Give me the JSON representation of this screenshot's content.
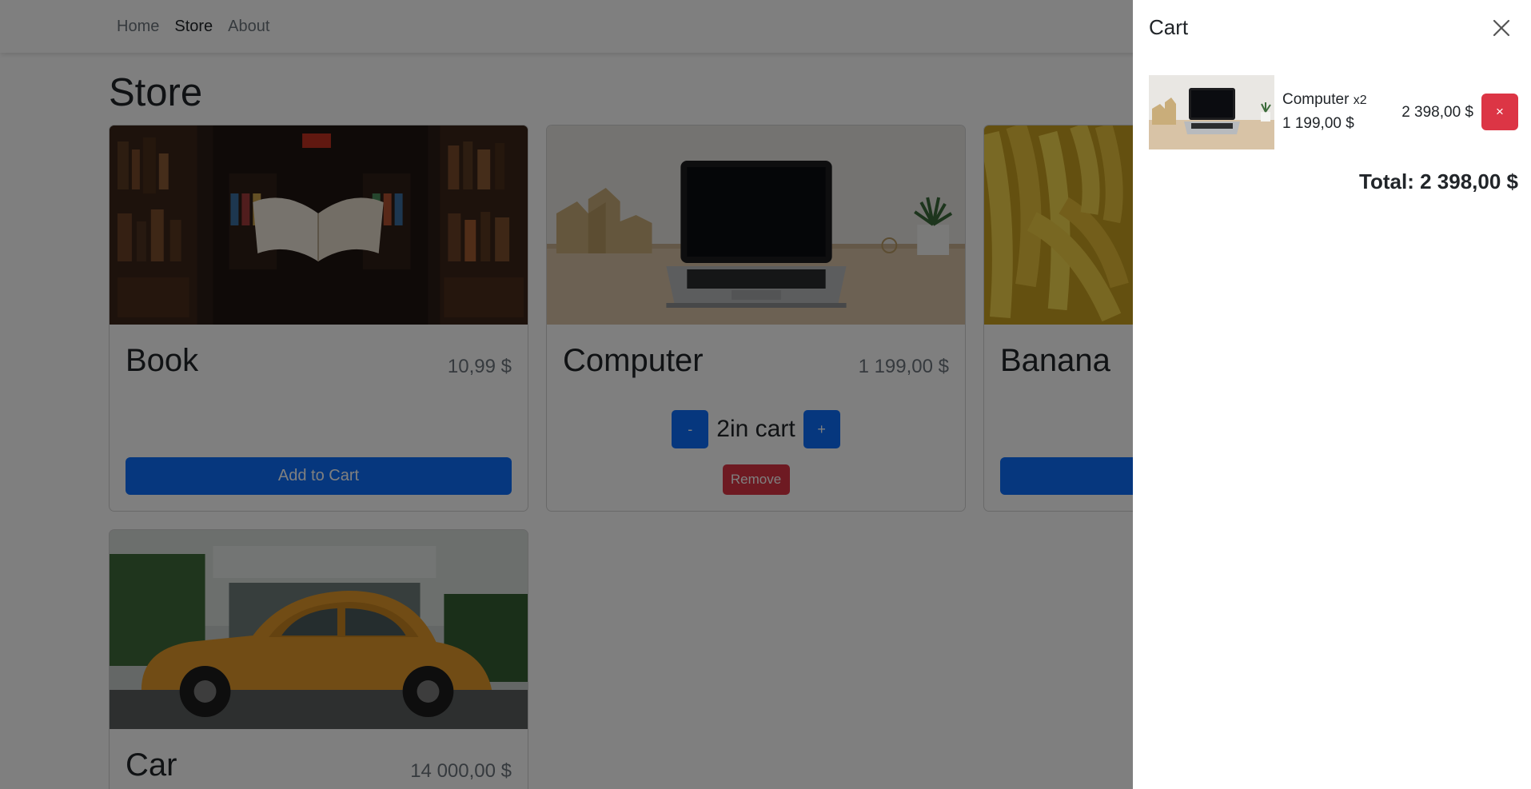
{
  "nav": {
    "items": [
      {
        "label": "Home",
        "active": false
      },
      {
        "label": "Store",
        "active": true
      },
      {
        "label": "About",
        "active": false
      }
    ]
  },
  "store": {
    "title": "Store",
    "items": [
      {
        "name": "Book",
        "price": "10,99 $",
        "button_label": "Add to Cart",
        "image": "book-image"
      },
      {
        "name": "Computer",
        "price": "1 199,00 $",
        "quantity_text": "2in cart",
        "decrease_label": "-",
        "increase_label": "+",
        "remove_label": "Remove",
        "image": "computer-image"
      },
      {
        "name": "Banana",
        "price": "",
        "button_label": "",
        "image": "banana-image"
      },
      {
        "name": "Car",
        "price": "14 000,00 $",
        "image": "car-image"
      }
    ]
  },
  "cart": {
    "title": "Cart",
    "close_icon": "close-icon",
    "items": [
      {
        "name": "Computer",
        "quantity_label": "x2",
        "unit_price": "1 199,00 $",
        "line_total": "2 398,00 $",
        "remove_label": "×",
        "image": "computer-image"
      }
    ],
    "total": "Total: 2 398,00 $"
  },
  "colors": {
    "primary": "#0d6efd",
    "danger": "#dc3545",
    "backdrop": "rgba(0,0,0,0.5)"
  }
}
